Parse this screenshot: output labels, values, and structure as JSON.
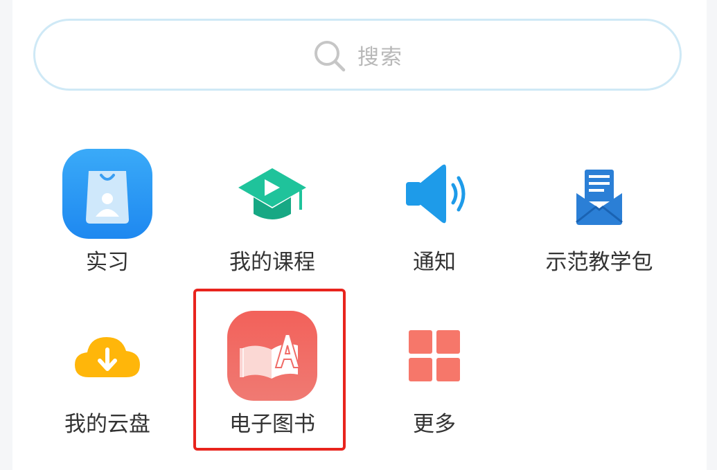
{
  "search": {
    "placeholder": "搜索",
    "icon": "search-icon"
  },
  "apps": [
    {
      "label": "实习",
      "icon": "internship-bag-icon",
      "color": "#2196f3"
    },
    {
      "label": "我的课程",
      "icon": "course-cap-icon",
      "color": "#1fc39b"
    },
    {
      "label": "通知",
      "icon": "speaker-icon",
      "color": "#1e9be9"
    },
    {
      "label": "示范教学包",
      "icon": "mail-envelope-icon",
      "color": "#2b7fd6"
    },
    {
      "label": "我的云盘",
      "icon": "cloud-download-icon",
      "color": "#ffb60a"
    },
    {
      "label": "电子图书",
      "icon": "ebook-icon",
      "color": "#f06b66"
    },
    {
      "label": "更多",
      "icon": "grid-more-icon",
      "color": "#f6776a"
    }
  ],
  "highlight": {
    "color": "#e8241d"
  }
}
